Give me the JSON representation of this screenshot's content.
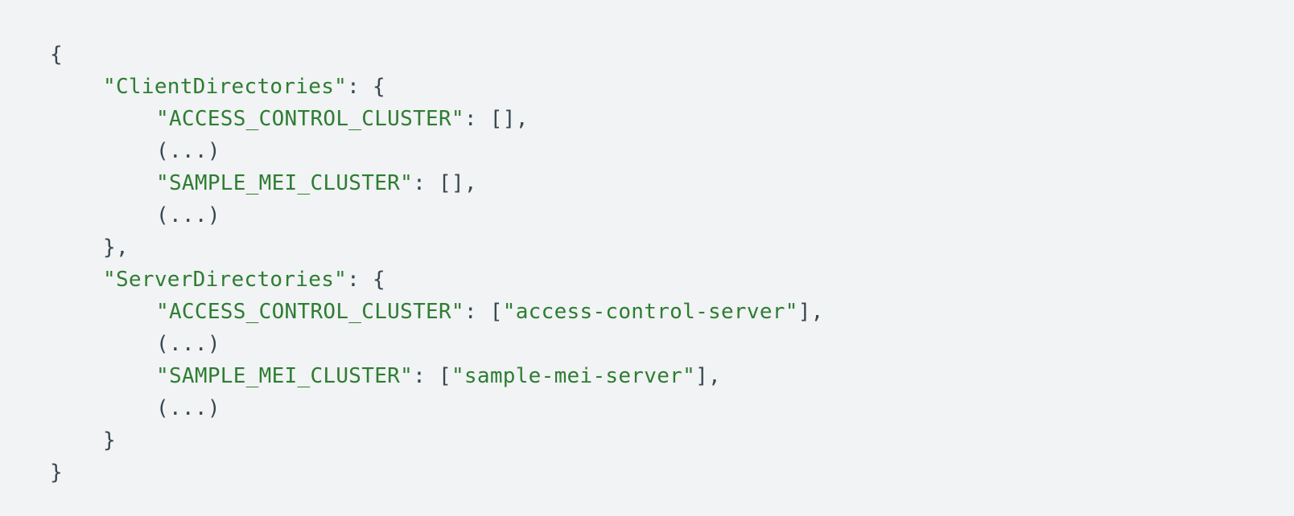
{
  "colors": {
    "background": "#f1f3f4",
    "punctuation": "#37474f",
    "string": "#2e7d32"
  },
  "code": {
    "open_root": "{",
    "client_key": "\"ClientDirectories\"",
    "client_open": ": {",
    "client_entry_1_key": "\"ACCESS_CONTROL_CLUSTER\"",
    "client_entry_1_value": ": [],",
    "client_ellipsis_1": "(...)",
    "client_entry_2_key": "\"SAMPLE_MEI_CLUSTER\"",
    "client_entry_2_value": ": [],",
    "client_ellipsis_2": "(...)",
    "client_close": "},",
    "server_key": "\"ServerDirectories\"",
    "server_open": ": {",
    "server_entry_1_key": "\"ACCESS_CONTROL_CLUSTER\"",
    "server_entry_1_sep": ": [",
    "server_entry_1_value": "\"access-control-server\"",
    "server_entry_1_end": "],",
    "server_ellipsis_1": "(...)",
    "server_entry_2_key": "\"SAMPLE_MEI_CLUSTER\"",
    "server_entry_2_sep": ": [",
    "server_entry_2_value": "\"sample-mei-server\"",
    "server_entry_2_end": "],",
    "server_ellipsis_2": "(...)",
    "server_close": "}",
    "close_root": "}"
  }
}
